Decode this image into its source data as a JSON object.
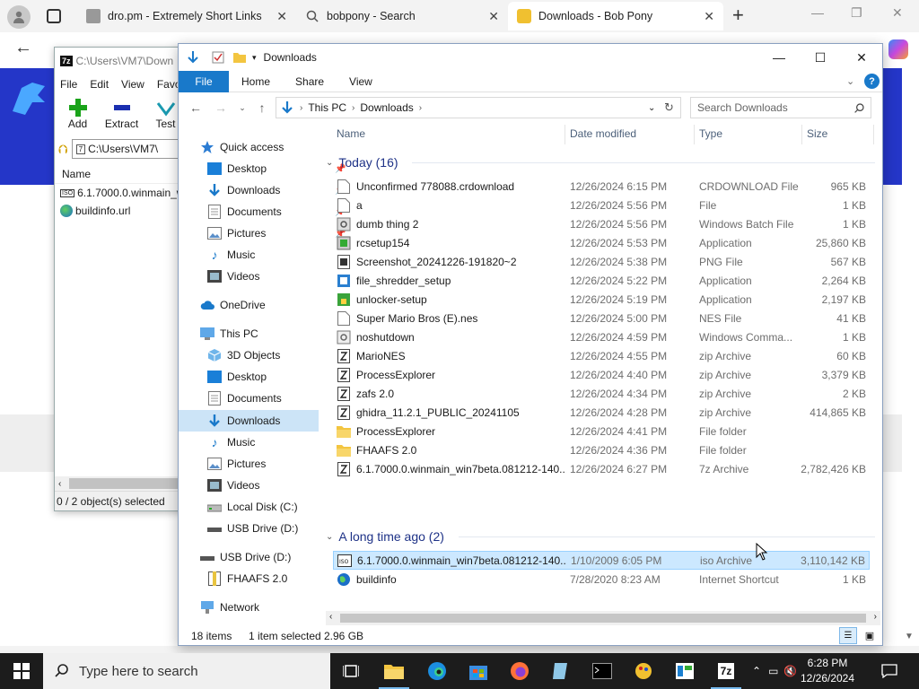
{
  "browser": {
    "tabs": [
      {
        "title": "dro.pm - Extremely Short Links"
      },
      {
        "title": "bobpony - Search"
      },
      {
        "title": "Downloads - Bob Pony"
      }
    ]
  },
  "sevenzip": {
    "title": "C:\\Users\\VM7\\Down",
    "menu": [
      "File",
      "Edit",
      "View",
      "Favo"
    ],
    "tools": [
      "Add",
      "Extract",
      "Test"
    ],
    "path": "C:\\Users\\VM7\\",
    "column": "Name",
    "items": [
      "6.1.7000.0.winmain_w",
      "buildinfo.url"
    ],
    "status": "0 / 2 object(s) selected"
  },
  "explorer": {
    "title": "Downloads",
    "ribbon": {
      "file": "File",
      "tabs": [
        "Home",
        "Share",
        "View"
      ]
    },
    "breadcrumb": [
      "This PC",
      "Downloads"
    ],
    "search_placeholder": "Search Downloads",
    "nav": {
      "quick_access": "Quick access",
      "quick_items": [
        "Desktop",
        "Downloads",
        "Documents",
        "Pictures",
        "Music",
        "Videos"
      ],
      "onedrive": "OneDrive",
      "this_pc": "This PC",
      "pc_items": [
        "3D Objects",
        "Desktop",
        "Documents",
        "Downloads",
        "Music",
        "Pictures",
        "Videos",
        "Local Disk (C:)",
        "USB Drive (D:)"
      ],
      "usb_drive": "USB Drive (D:)",
      "usb_items": [
        "FHAAFS 2.0"
      ],
      "network": "Network"
    },
    "columns": {
      "name": "Name",
      "date": "Date modified",
      "type": "Type",
      "size": "Size"
    },
    "groups": [
      {
        "label": "Today (16)",
        "files": [
          {
            "name": "Unconfirmed 778088.crdownload",
            "date": "12/26/2024 6:15 PM",
            "type": "CRDOWNLOAD File",
            "size": "965 KB",
            "icon": "blank-file-icon"
          },
          {
            "name": "a",
            "date": "12/26/2024 5:56 PM",
            "type": "File",
            "size": "1 KB",
            "icon": "blank-file-icon"
          },
          {
            "name": "dumb thing 2",
            "date": "12/26/2024 5:56 PM",
            "type": "Windows Batch File",
            "size": "1 KB",
            "icon": "batch-file-icon"
          },
          {
            "name": "rcsetup154",
            "date": "12/26/2024 5:53 PM",
            "type": "Application",
            "size": "25,860 KB",
            "icon": "setup-app-icon"
          },
          {
            "name": "Screenshot_20241226-191820~2",
            "date": "12/26/2024 5:38 PM",
            "type": "PNG File",
            "size": "567 KB",
            "icon": "image-file-icon"
          },
          {
            "name": "file_shredder_setup",
            "date": "12/26/2024 5:22 PM",
            "type": "Application",
            "size": "2,264 KB",
            "icon": "shredder-app-icon"
          },
          {
            "name": "unlocker-setup",
            "date": "12/26/2024 5:19 PM",
            "type": "Application",
            "size": "2,197 KB",
            "icon": "unlocker-app-icon"
          },
          {
            "name": "Super Mario Bros (E).nes",
            "date": "12/26/2024 5:00 PM",
            "type": "NES File",
            "size": "41 KB",
            "icon": "blank-file-icon"
          },
          {
            "name": "noshutdown",
            "date": "12/26/2024 4:59 PM",
            "type": "Windows Comma...",
            "size": "1 KB",
            "icon": "command-file-icon"
          },
          {
            "name": "MarioNES",
            "date": "12/26/2024 4:55 PM",
            "type": "zip Archive",
            "size": "60 KB",
            "icon": "zip-archive-icon"
          },
          {
            "name": "ProcessExplorer",
            "date": "12/26/2024 4:40 PM",
            "type": "zip Archive",
            "size": "3,379 KB",
            "icon": "zip-archive-icon"
          },
          {
            "name": "zafs 2.0",
            "date": "12/26/2024 4:34 PM",
            "type": "zip Archive",
            "size": "2 KB",
            "icon": "zip-archive-icon"
          },
          {
            "name": "ghidra_11.2.1_PUBLIC_20241105",
            "date": "12/26/2024 4:28 PM",
            "type": "zip Archive",
            "size": "414,865 KB",
            "icon": "zip-archive-icon"
          },
          {
            "name": "ProcessExplorer",
            "date": "12/26/2024 4:41 PM",
            "type": "File folder",
            "size": "",
            "icon": "folder-icon"
          },
          {
            "name": "FHAAFS 2.0",
            "date": "12/26/2024 4:36 PM",
            "type": "File folder",
            "size": "",
            "icon": "folder-icon"
          },
          {
            "name": "6.1.7000.0.winmain_win7beta.081212-140...",
            "date": "12/26/2024 6:27 PM",
            "type": "7z Archive",
            "size": "2,782,426 KB",
            "icon": "zip-archive-icon"
          }
        ]
      },
      {
        "label": "A long time ago (2)",
        "files": [
          {
            "name": "6.1.7000.0.winmain_win7beta.081212-140...",
            "date": "1/10/2009 6:05 PM",
            "type": "iso Archive",
            "size": "3,110,142 KB",
            "icon": "iso-archive-icon",
            "selected": true
          },
          {
            "name": "buildinfo",
            "date": "7/28/2020 8:23 AM",
            "type": "Internet Shortcut",
            "size": "1 KB",
            "icon": "internet-shortcut-icon"
          }
        ]
      }
    ],
    "status": {
      "count": "18 items",
      "selection": "1 item selected",
      "size": "2.96 GB"
    }
  },
  "taskbar": {
    "search_placeholder": "Type here to search",
    "clock_time": "6:28 PM",
    "clock_date": "12/26/2024"
  },
  "colors": {
    "accent": "#1979ca",
    "selection": "#cce8ff",
    "group_header": "#1e3287",
    "taskbar": "#1c1c1c"
  }
}
